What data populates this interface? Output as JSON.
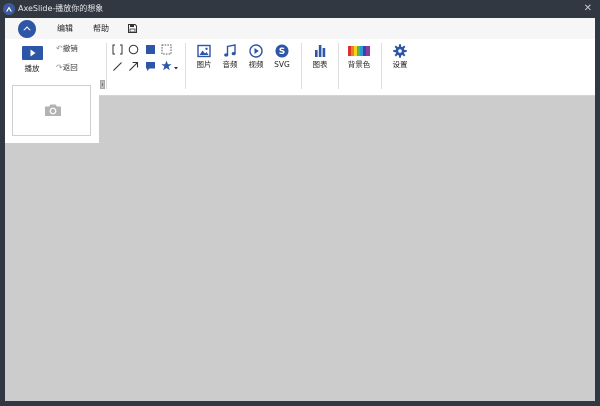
{
  "window": {
    "title": "AxeSlide-播放你的想象"
  },
  "menu": {
    "edit": "编辑",
    "help": "帮助"
  },
  "ribbon": {
    "play": "播放",
    "undo": "撤销",
    "redo": "返回",
    "image": "图片",
    "audio": "音频",
    "video": "视频",
    "svg": "SVG",
    "chart": "图表",
    "background": "背景色",
    "settings": "设置"
  },
  "colors": {
    "accent": "#2e56a6",
    "titlebar": "#323841",
    "canvas": "#cccccc"
  },
  "icons": [
    "home-icon",
    "save-icon",
    "play-icon",
    "undo-icon",
    "redo-icon",
    "bracket-frame-icon",
    "circle-icon",
    "square-icon",
    "dashed-rect-icon",
    "line-icon",
    "arrow-icon",
    "callout-icon",
    "star-icon",
    "image-icon",
    "music-icon",
    "video-icon",
    "svg-icon",
    "bar-chart-icon",
    "rainbow-icon",
    "gear-icon",
    "camera-icon"
  ]
}
